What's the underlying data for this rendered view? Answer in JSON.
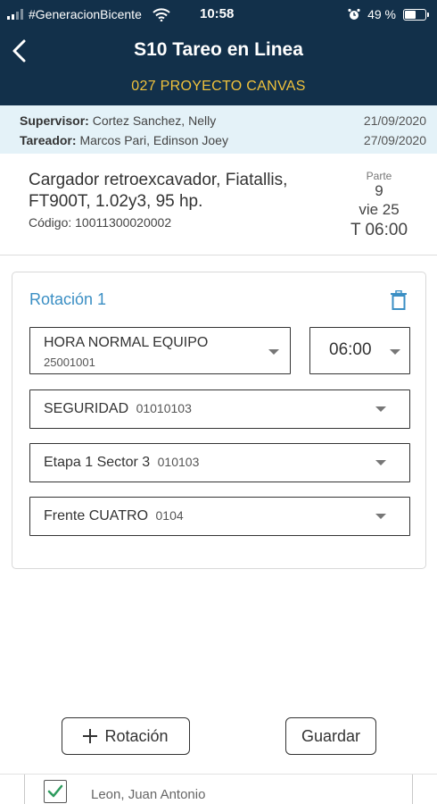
{
  "status_bar": {
    "carrier": "#GeneracionBicente",
    "time": "10:58",
    "battery": "49 %",
    "battery_level": 0.49,
    "icons": [
      "signal-icon",
      "wifi-icon",
      "alarm-icon",
      "battery-icon"
    ]
  },
  "header": {
    "title": "S10 Tareo en Linea",
    "subtitle": "027 PROYECTO CANVAS",
    "back_icon": "chevron-left-icon"
  },
  "info": {
    "supervisor_label": "Supervisor:",
    "supervisor_name": "Cortez Sanchez, Nelly",
    "supervisor_date": "21/09/2020",
    "tareador_label": "Tareador:",
    "tareador_name": "Marcos Pari, Edinson Joey",
    "tareador_date": "27/09/2020"
  },
  "equipment": {
    "name": "Cargador retroexcavador, Fiatallis, FT900T, 1.02y3, 95 hp.",
    "code": "Código: 10011300020002",
    "parte_label": "Parte",
    "parte_number": "9",
    "day": "vie 25",
    "turn": "T 06:00"
  },
  "rotation": {
    "title": "Rotación 1",
    "delete_icon": "trash-icon",
    "hour_type": {
      "label": "HORA NORMAL EQUIPO",
      "code": "25001001"
    },
    "time": "06:00",
    "category": {
      "label": "SEGURIDAD",
      "code": "01010103"
    },
    "stage": {
      "label": "Etapa 1 Sector 3",
      "code": "010103"
    },
    "front": {
      "label": "Frente CUATRO",
      "code": "0104"
    }
  },
  "actions": {
    "add_rotation": "Rotación",
    "save": "Guardar"
  },
  "peek": {
    "text": "Leon, Juan Antonio",
    "checked": true
  },
  "colors": {
    "header_bg": "#12304a",
    "subtitle": "#f0c23c",
    "accent": "#3b8fc4",
    "info_bg": "#e4f2f8",
    "check": "#2e9b5e"
  }
}
